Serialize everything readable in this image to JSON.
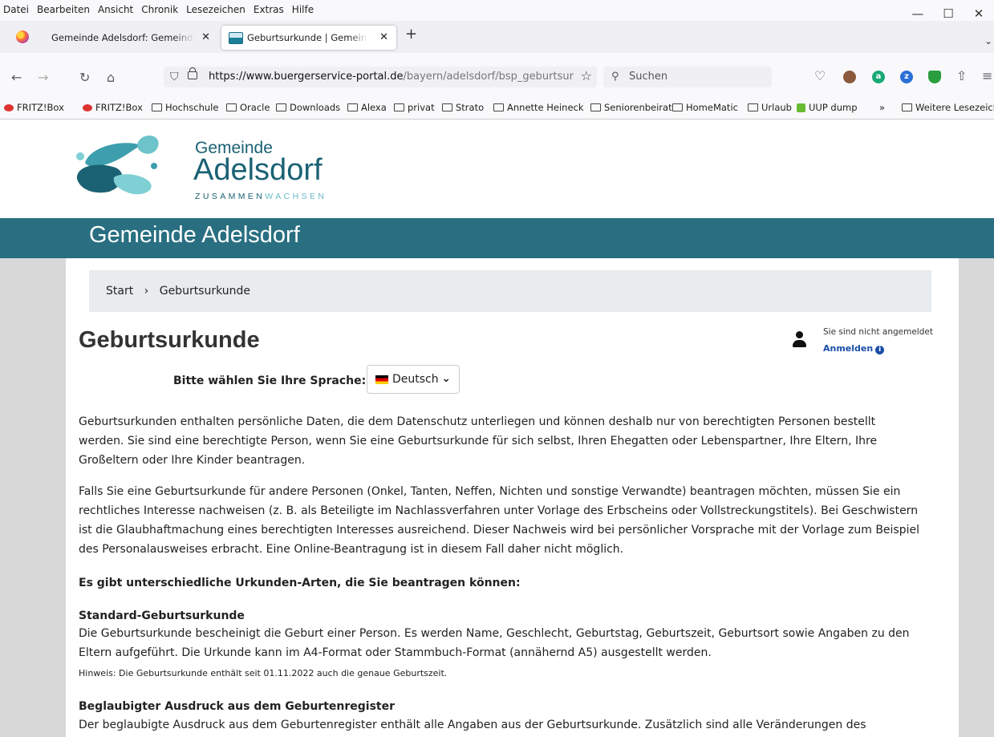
{
  "menu": [
    "Datei",
    "Bearbeiten",
    "Ansicht",
    "Chronik",
    "Lesezeichen",
    "Extras",
    "Hilfe"
  ],
  "window_controls": {
    "minimize": "—",
    "maximize": "☐",
    "close": "✕"
  },
  "tabs": [
    {
      "label": "Gemeinde Adelsdorf: Gemeinde Adelsdorf",
      "close": "✕"
    },
    {
      "label": "Geburtsurkunde | Gemeinde Adelsdorf",
      "close": "✕"
    }
  ],
  "new_tab": "+",
  "tab_list": "⌄",
  "nav": {
    "back": "←",
    "forward": "→",
    "reload": "↻",
    "home": "⌂"
  },
  "url": {
    "host": "https://www.buergerservice-portal.de",
    "path": "/bayern/adelsdorf/bsp_geburtsurkunde",
    "star": "☆"
  },
  "search": {
    "placeholder": "Suchen",
    "icon": "⚲"
  },
  "toolbar_icons": {
    "pocket": "♡",
    "share": "⇧",
    "menu": "≡"
  },
  "extensions": [
    {
      "name": "profile-icon",
      "letter": "",
      "color": "#8b5a3c"
    },
    {
      "name": "a-extension-icon",
      "letter": "a",
      "color": "#19a974"
    },
    {
      "name": "z-extension-icon",
      "letter": "z",
      "color": "#2b6fd6"
    },
    {
      "name": "shield-extension-icon",
      "letter": "",
      "color": "#2a9d3f"
    }
  ],
  "bookmarks": [
    "FRITZ!Box",
    "FRITZ!Box",
    "Hochschule",
    "Oracle",
    "Downloads",
    "Alexa",
    "privat",
    "Strato",
    "Annette Heineck",
    "Seniorenbeirat",
    "HomeMatic",
    "Urlaub",
    "UUP dump"
  ],
  "bookmarks_overflow": "»",
  "bookmarks_other": "Weitere Lesezeichen",
  "logo": {
    "line1": "Gemeinde",
    "line2": "Adelsdorf",
    "tag1": "ZUSAMMEN",
    "tag2": "WACHSEN"
  },
  "banner_title": "Gemeinde Adelsdorf",
  "breadcrumb": {
    "start": "Start",
    "sep": "›",
    "current": "Geburtsurkunde"
  },
  "page_title": "Geburtsurkunde",
  "user": {
    "status": "Sie sind nicht angemeldet",
    "login": "Anmelden",
    "info": "i"
  },
  "language": {
    "label": "Bitte wählen Sie Ihre Sprache:",
    "selected": "Deutsch",
    "chevron": "⌄"
  },
  "content": {
    "p1": "Geburtsurkunden enthalten persönliche Daten, die dem Datenschutz unterliegen und können deshalb nur von berechtigten Personen bestellt werden. Sie sind eine berechtigte Person, wenn Sie eine Geburtsurkunde für sich selbst, Ihren Ehegatten oder Lebenspartner, Ihre Eltern, Ihre Großeltern oder Ihre Kinder beantragen.",
    "p2": "Falls Sie eine Geburtsurkunde für andere Personen (Onkel, Tanten, Neffen, Nichten und sonstige Verwandte) beantragen möchten, müssen Sie ein rechtliches Interesse nachweisen (z. B. als Beteiligte im Nachlassverfahren unter Vorlage des Erbscheins oder Vollstreckungstitels). Bei Geschwistern ist die Glaubhaftmachung eines berechtigten Interesses ausreichend. Dieser Nachweis wird bei persönlicher Vorsprache mit der Vorlage zum Beispiel des Personalausweises erbracht. Eine Online-Beantragung ist in diesem Fall daher nicht möglich.",
    "types_heading": "Es gibt unterschiedliche Urkunden-Arten, die Sie beantragen können:",
    "std_title": "Standard-Geburtsurkunde",
    "std_text": "Die Geburtsurkunde bescheinigt die Geburt einer Person. Es werden Name, Geschlecht, Geburtstag, Geburtszeit, Geburtsort sowie Angaben zu den Eltern aufgeführt. Die Urkunde kann im A4-Format oder Stammbuch-Format (annähernd A5) ausgestellt werden.",
    "std_hint": "Hinweis: Die Geburtsurkunde enthält seit 01.11.2022 auch die genaue Geburtszeit.",
    "register_title": "Beglaubigter Ausdruck aus dem Geburtenregister",
    "register_text": "Der beglaubigte Ausdruck aus dem Geburtenregister enthält alle Angaben aus der Geburtsurkunde. Zusätzlich sind alle Veränderungen des"
  }
}
